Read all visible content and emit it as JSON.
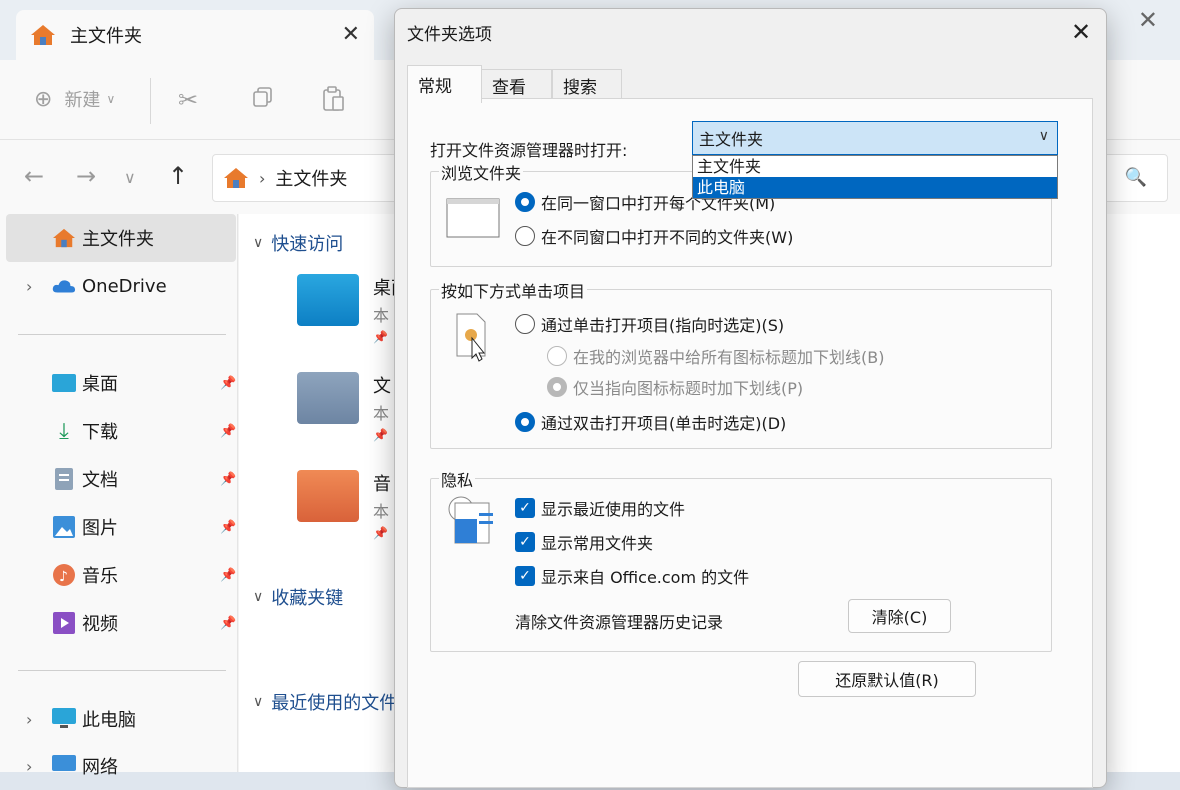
{
  "explorer": {
    "tab_title": "主文件夹",
    "close_glyph": "✕",
    "toolbar": {
      "new_label": "新建"
    },
    "address": {
      "path": "主文件夹"
    },
    "sidebar": {
      "home": "主文件夹",
      "onedrive": "OneDrive",
      "pinned": [
        "桌面",
        "下载",
        "文档",
        "图片",
        "音乐",
        "视频"
      ],
      "this_pc": "此电脑",
      "network": "网络"
    },
    "content": {
      "quick_access": "快速访问",
      "favorites": "收藏夹键",
      "recent": "最近使用的文件",
      "items": [
        {
          "name": "桌面",
          "sub": "本"
        },
        {
          "name": "文",
          "sub": "本"
        },
        {
          "name": "音",
          "sub": "本"
        }
      ]
    }
  },
  "dialog": {
    "title": "文件夹选项",
    "close_glyph": "✕",
    "tabs": [
      "常规",
      "查看",
      "搜索"
    ],
    "open_label": "打开文件资源管理器时打开:",
    "combo_value": "主文件夹",
    "combo_options": [
      "主文件夹",
      "此电脑"
    ],
    "browse_group": {
      "legend": "浏览文件夹",
      "same_window": "在同一窗口中打开每个文件夹(M)",
      "new_window": "在不同窗口中打开不同的文件夹(W)"
    },
    "click_group": {
      "legend": "按如下方式单击项目",
      "single_click": "通过单击打开项目(指向时选定)(S)",
      "underline_all": "在我的浏览器中给所有图标标题加下划线(B)",
      "underline_hover": "仅当指向图标标题时加下划线(P)",
      "double_click": "通过双击打开项目(单击时选定)(D)"
    },
    "privacy_group": {
      "legend": "隐私",
      "recent_files": "显示最近使用的文件",
      "frequent_folders": "显示常用文件夹",
      "office_files": "显示来自 Office.com 的文件",
      "clear_label": "清除文件资源管理器历史记录",
      "clear_button": "清除(C)"
    },
    "restore_button": "还原默认值(R)"
  },
  "colors": {
    "accent": "#0067c0",
    "selection_blue": "#cce4f7"
  }
}
